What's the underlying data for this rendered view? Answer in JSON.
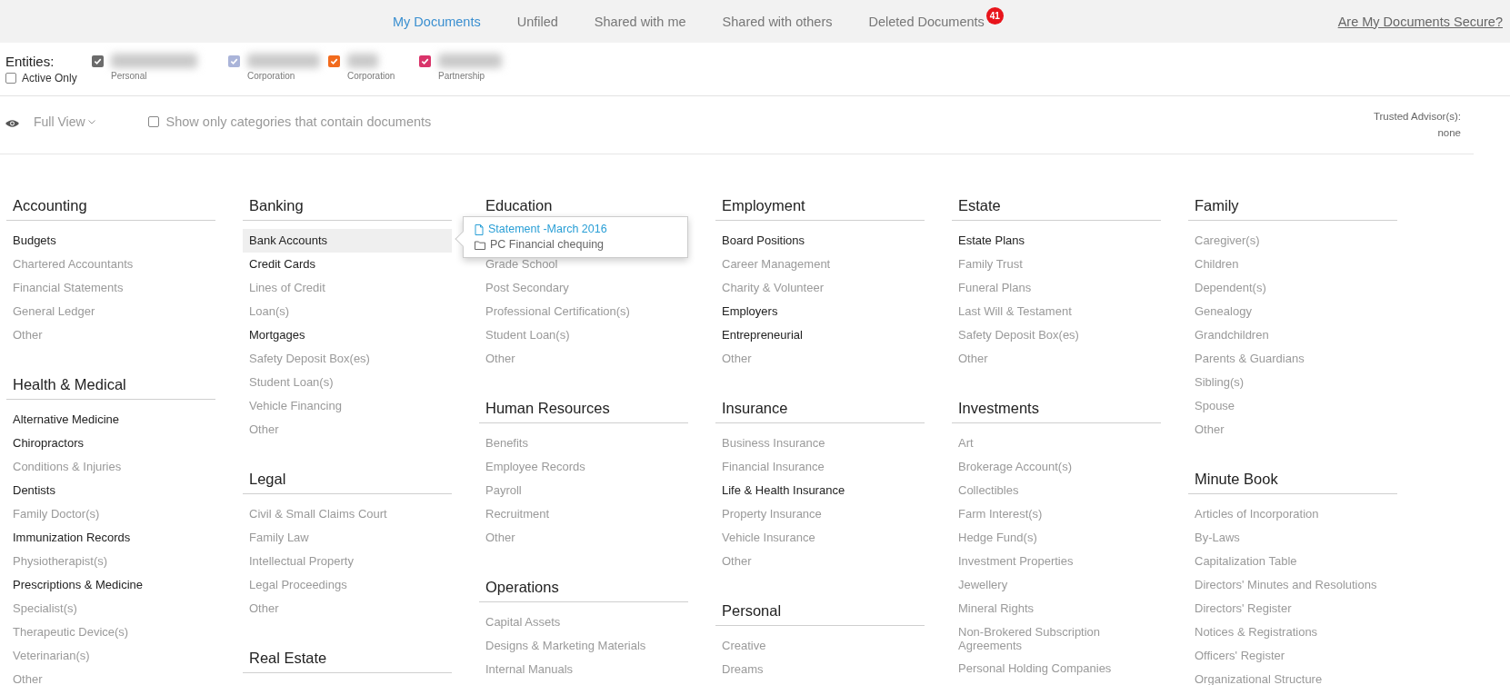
{
  "nav": {
    "tabs": [
      {
        "label": "My Documents",
        "selected": true
      },
      {
        "label": "Unfiled",
        "selected": false
      },
      {
        "label": "Shared with me",
        "selected": false
      },
      {
        "label": "Shared with others",
        "selected": false
      },
      {
        "label": "Deleted Documents",
        "selected": false,
        "badge": "41"
      }
    ],
    "security_link": "Are My Documents Secure?"
  },
  "entities": {
    "label": "Entities:",
    "active_only": {
      "label": "Active Only",
      "checked": false
    },
    "items": [
      {
        "type": "Personal",
        "checked": true,
        "color": "#6b6b6b"
      },
      {
        "type": "Corporation",
        "checked": true,
        "color": "#aab4d9"
      },
      {
        "type": "Corporation",
        "checked": true,
        "color": "#f26b1d"
      },
      {
        "type": "Partnership",
        "checked": true,
        "color": "#d9346a"
      }
    ]
  },
  "toolbar": {
    "view": "Full View",
    "filter": {
      "label": "Show only categories that contain documents",
      "checked": false
    },
    "advisors_label": "Trusted Advisor(s):",
    "advisors_value": "none"
  },
  "columns": [
    {
      "sections": [
        {
          "title": "Accounting",
          "items": [
            {
              "label": "Budgets",
              "has_documents": true
            },
            {
              "label": "Chartered Accountants",
              "has_documents": false
            },
            {
              "label": "Financial Statements",
              "has_documents": false
            },
            {
              "label": "General Ledger",
              "has_documents": false
            },
            {
              "label": "Other",
              "has_documents": false
            }
          ]
        },
        {
          "title": "Health & Medical",
          "items": [
            {
              "label": "Alternative Medicine",
              "has_documents": true
            },
            {
              "label": "Chiropractors",
              "has_documents": true
            },
            {
              "label": "Conditions & Injuries",
              "has_documents": false
            },
            {
              "label": "Dentists",
              "has_documents": true
            },
            {
              "label": "Family Doctor(s)",
              "has_documents": false
            },
            {
              "label": "Immunization Records",
              "has_documents": true
            },
            {
              "label": "Physiotherapist(s)",
              "has_documents": false
            },
            {
              "label": "Prescriptions & Medicine",
              "has_documents": true
            },
            {
              "label": "Specialist(s)",
              "has_documents": false
            },
            {
              "label": "Therapeutic Device(s)",
              "has_documents": false
            },
            {
              "label": "Veterinarian(s)",
              "has_documents": false
            },
            {
              "label": "Other",
              "has_documents": false
            }
          ]
        }
      ]
    },
    {
      "sections": [
        {
          "title": "Banking",
          "items": [
            {
              "label": "Bank Accounts",
              "has_documents": true,
              "hovered": true,
              "popover": {
                "document": "Statement -March 2016",
                "folder": "PC Financial chequing"
              }
            },
            {
              "label": "Credit Cards",
              "has_documents": true
            },
            {
              "label": "Lines of Credit",
              "has_documents": false
            },
            {
              "label": "Loan(s)",
              "has_documents": false
            },
            {
              "label": "Mortgages",
              "has_documents": true
            },
            {
              "label": "Safety Deposit Box(es)",
              "has_documents": false
            },
            {
              "label": "Student Loan(s)",
              "has_documents": false
            },
            {
              "label": "Vehicle Financing",
              "has_documents": false
            },
            {
              "label": "Other",
              "has_documents": false
            }
          ]
        },
        {
          "title": "Legal",
          "items": [
            {
              "label": "Civil & Small Claims Court",
              "has_documents": false
            },
            {
              "label": "Family Law",
              "has_documents": false
            },
            {
              "label": "Intellectual Property",
              "has_documents": false
            },
            {
              "label": "Legal Proceedings",
              "has_documents": false
            },
            {
              "label": "Other",
              "has_documents": false
            }
          ]
        },
        {
          "title": "Real Estate"
        }
      ]
    },
    {
      "sections": [
        {
          "title": "Education",
          "items": [
            {
              "label": "Grade School",
              "has_documents": false
            },
            {
              "label": "Post Secondary",
              "has_documents": false
            },
            {
              "label": "Professional Certification(s)",
              "has_documents": false
            },
            {
              "label": "Student Loan(s)",
              "has_documents": false
            },
            {
              "label": "Other",
              "has_documents": false
            }
          ]
        },
        {
          "title": "Human Resources",
          "items": [
            {
              "label": "Benefits",
              "has_documents": false
            },
            {
              "label": "Employee Records",
              "has_documents": false
            },
            {
              "label": "Payroll",
              "has_documents": false
            },
            {
              "label": "Recruitment",
              "has_documents": false
            },
            {
              "label": "Other",
              "has_documents": false
            }
          ]
        },
        {
          "title": "Operations",
          "items": [
            {
              "label": "Capital Assets",
              "has_documents": false
            },
            {
              "label": "Designs & Marketing Materials",
              "has_documents": false
            },
            {
              "label": "Internal Manuals",
              "has_documents": false
            }
          ]
        }
      ]
    },
    {
      "sections": [
        {
          "title": "Employment",
          "items": [
            {
              "label": "Board Positions",
              "has_documents": true
            },
            {
              "label": "Career Management",
              "has_documents": false
            },
            {
              "label": "Charity & Volunteer",
              "has_documents": false
            },
            {
              "label": "Employers",
              "has_documents": true
            },
            {
              "label": "Entrepreneurial",
              "has_documents": true
            },
            {
              "label": "Other",
              "has_documents": false
            }
          ]
        },
        {
          "title": "Insurance",
          "items": [
            {
              "label": "Business Insurance",
              "has_documents": false
            },
            {
              "label": "Financial Insurance",
              "has_documents": false
            },
            {
              "label": "Life & Health Insurance",
              "has_documents": true
            },
            {
              "label": "Property Insurance",
              "has_documents": false
            },
            {
              "label": "Vehicle Insurance",
              "has_documents": false
            },
            {
              "label": "Other",
              "has_documents": false
            }
          ]
        },
        {
          "title": "Personal",
          "items": [
            {
              "label": "Creative",
              "has_documents": false
            },
            {
              "label": "Dreams",
              "has_documents": false
            }
          ]
        }
      ]
    },
    {
      "sections": [
        {
          "title": "Estate",
          "items": [
            {
              "label": "Estate Plans",
              "has_documents": true
            },
            {
              "label": "Family Trust",
              "has_documents": false
            },
            {
              "label": "Funeral Plans",
              "has_documents": false
            },
            {
              "label": "Last Will & Testament",
              "has_documents": false
            },
            {
              "label": "Safety Deposit Box(es)",
              "has_documents": false
            },
            {
              "label": "Other",
              "has_documents": false
            }
          ]
        },
        {
          "title": "Investments",
          "items": [
            {
              "label": "Art",
              "has_documents": false
            },
            {
              "label": "Brokerage Account(s)",
              "has_documents": false
            },
            {
              "label": "Collectibles",
              "has_documents": false
            },
            {
              "label": "Farm Interest(s)",
              "has_documents": false
            },
            {
              "label": "Hedge Fund(s)",
              "has_documents": false
            },
            {
              "label": "Investment Properties",
              "has_documents": false
            },
            {
              "label": "Jewellery",
              "has_documents": false
            },
            {
              "label": "Mineral Rights",
              "has_documents": false
            },
            {
              "label": "Non-Brokered Subscription Agreements",
              "has_documents": false
            },
            {
              "label": "Personal Holding Companies",
              "has_documents": false
            }
          ]
        }
      ]
    },
    {
      "sections": [
        {
          "title": "Family",
          "items": [
            {
              "label": "Caregiver(s)",
              "has_documents": false
            },
            {
              "label": "Children",
              "has_documents": false
            },
            {
              "label": "Dependent(s)",
              "has_documents": false
            },
            {
              "label": "Genealogy",
              "has_documents": false
            },
            {
              "label": "Grandchildren",
              "has_documents": false
            },
            {
              "label": "Parents & Guardians",
              "has_documents": false
            },
            {
              "label": "Sibling(s)",
              "has_documents": false
            },
            {
              "label": "Spouse",
              "has_documents": false
            },
            {
              "label": "Other",
              "has_documents": false
            }
          ]
        },
        {
          "title": "Minute Book",
          "items": [
            {
              "label": "Articles of Incorporation",
              "has_documents": false
            },
            {
              "label": "By-Laws",
              "has_documents": false
            },
            {
              "label": "Capitalization Table",
              "has_documents": false
            },
            {
              "label": "Directors' Minutes and Resolutions",
              "has_documents": false
            },
            {
              "label": "Directors' Register",
              "has_documents": false
            },
            {
              "label": "Notices & Registrations",
              "has_documents": false
            },
            {
              "label": "Officers' Register",
              "has_documents": false
            },
            {
              "label": "Organizational Structure",
              "has_documents": false
            }
          ]
        }
      ]
    }
  ]
}
